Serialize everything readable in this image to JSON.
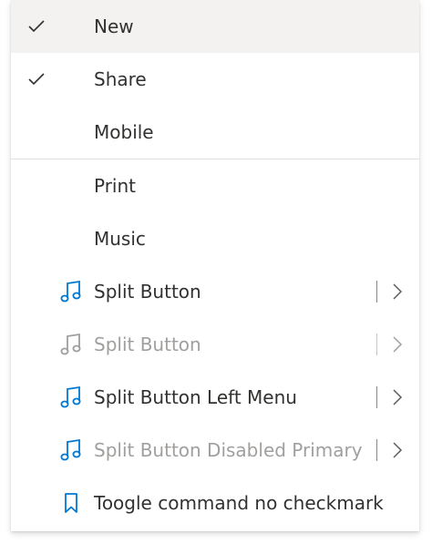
{
  "menu": {
    "items": [
      {
        "label": "New",
        "checked": true,
        "hovered": true
      },
      {
        "label": "Share",
        "checked": true
      },
      {
        "label": "Mobile",
        "checked": false
      },
      {
        "label": "Print"
      },
      {
        "label": "Music"
      },
      {
        "label": "Split Button",
        "icon": "music-note-icon",
        "icon_color": "#0078d4",
        "split": true
      },
      {
        "label": "Split Button",
        "icon": "music-note-icon",
        "icon_color": "#a19f9d",
        "split": true,
        "disabled": true
      },
      {
        "label": "Split Button Left Menu",
        "icon": "music-note-icon",
        "icon_color": "#0078d4",
        "split": true
      },
      {
        "label": "Split Button Disabled Primary",
        "icon": "music-note-icon",
        "icon_color": "#0078d4",
        "split": true,
        "primary_disabled": true
      },
      {
        "label": "Toogle command no checkmark",
        "icon": "bookmark-icon",
        "icon_color": "#0078d4"
      }
    ]
  },
  "colors": {
    "accent": "#0078d4",
    "text": "#323130",
    "disabled_text": "#a19f9d",
    "hover_bg": "#f3f2f1",
    "divider": "#e1dfdd"
  }
}
